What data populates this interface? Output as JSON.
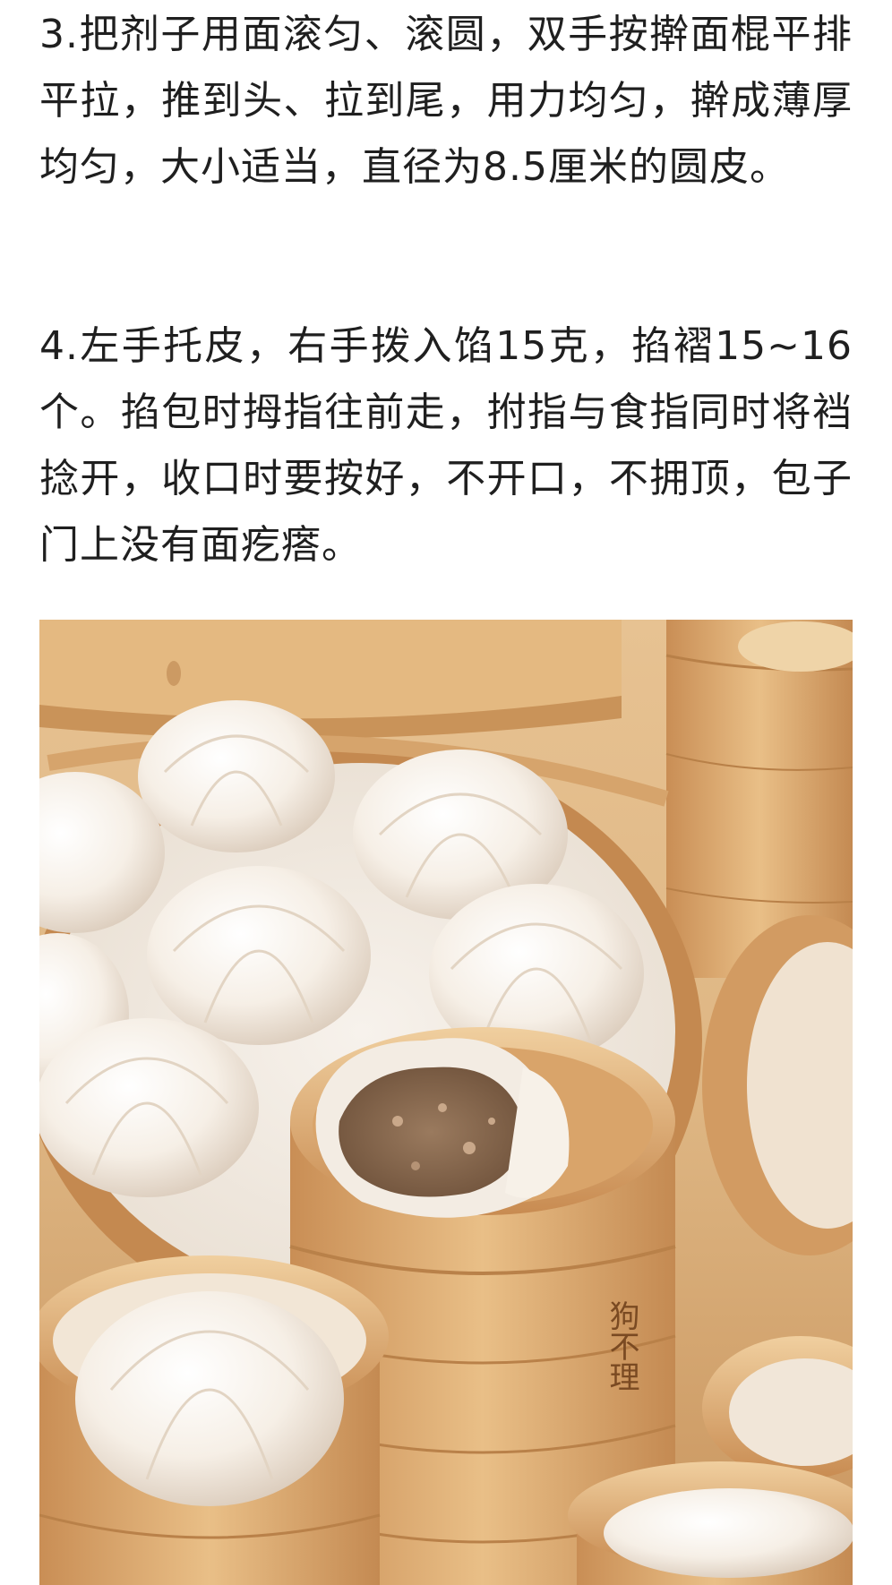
{
  "article": {
    "steps": [
      {
        "text": "3.把剂子用面滚匀、滚圆，双手按擀面棍平排平拉，推到头、拉到尾，用力均匀，擀成薄厚均匀，大小适当，直径为8.5厘米的圆皮。"
      },
      {
        "text": "4.左手托皮，右手拨入馅15克，掐褶15~16个。掐包时拇指往前走，拊指与食指同时将裆捻开，收口时要按好，不开口，不拥顶，包子门上没有面疙瘩。"
      }
    ],
    "photo": {
      "subject": "steamed-buns-in-bamboo-steamers",
      "steamer_stamp": "狗不理"
    }
  }
}
